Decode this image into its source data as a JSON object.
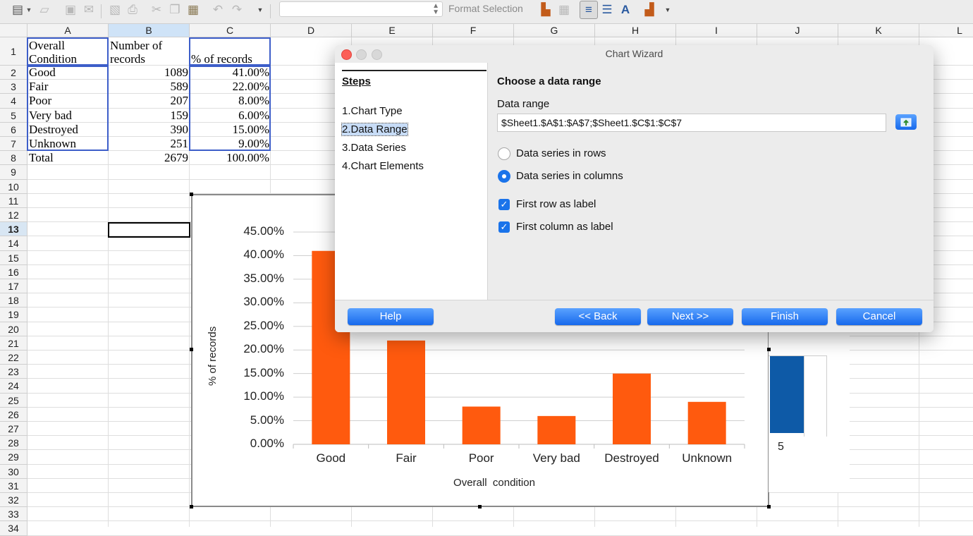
{
  "toolbar": {
    "format_selection_label": "Format Selection",
    "name_box_value": ""
  },
  "sheet": {
    "columns": [
      "A",
      "B",
      "C",
      "D",
      "E",
      "F",
      "G",
      "H",
      "I",
      "J",
      "K",
      "L"
    ],
    "rows": [
      "1",
      "2",
      "3",
      "4",
      "5",
      "6",
      "7",
      "8",
      "9",
      "10",
      "11",
      "12",
      "13",
      "14",
      "15",
      "16",
      "17",
      "18",
      "19",
      "20",
      "21",
      "22",
      "23",
      "24",
      "25",
      "26",
      "27",
      "28",
      "29",
      "30",
      "31",
      "32",
      "33",
      "34"
    ],
    "selected_row": "13",
    "header": {
      "a": "Overall Condition",
      "b": "Number of records",
      "c": "% of records"
    },
    "data_rows": [
      {
        "a": "Good",
        "b": "1089",
        "c": "41.00%"
      },
      {
        "a": "Fair",
        "b": "589",
        "c": "22.00%"
      },
      {
        "a": "Poor",
        "b": "207",
        "c": "8.00%"
      },
      {
        "a": "Very bad",
        "b": "159",
        "c": "6.00%"
      },
      {
        "a": "Destroyed",
        "b": "390",
        "c": "15.00%"
      },
      {
        "a": "Unknown",
        "b": "251",
        "c": "9.00%"
      },
      {
        "a": "Total",
        "b": "2679",
        "c": "100.00%"
      }
    ]
  },
  "chart_data": {
    "type": "bar",
    "categories": [
      "Good",
      "Fair",
      "Poor",
      "Very bad",
      "Destroyed",
      "Unknown"
    ],
    "values": [
      41,
      22,
      8,
      6,
      15,
      9
    ],
    "ylabel": "% of records",
    "xlabel": "Overall  condition",
    "ylim": [
      0,
      45
    ],
    "yticks": [
      "0.00%",
      "5.00%",
      "10.00%",
      "15.00%",
      "20.00%",
      "25.00%",
      "30.00%",
      "35.00%",
      "40.00%",
      "45.00%"
    ],
    "grid": true,
    "bar_color": "#ff5a0e"
  },
  "second_chart": {
    "tick_label": "5",
    "bar_color": "#0e5aa7"
  },
  "dialog": {
    "title": "Chart Wizard",
    "steps_title": "Steps",
    "steps": [
      {
        "num": "1.",
        "label": "Chart Type"
      },
      {
        "num": "2.",
        "label": "Data Range"
      },
      {
        "num": "3.",
        "label": "Data Series"
      },
      {
        "num": "4.",
        "label": "Chart Elements"
      }
    ],
    "heading": "Choose a data range",
    "data_range_label": "Data range",
    "data_range_value": "$Sheet1.$A$1:$A$7;$Sheet1.$C$1:$C$7",
    "radio_rows": "Data series in rows",
    "radio_columns": "Data series in columns",
    "check_first_row": "First row as label",
    "check_first_column": "First column as label",
    "buttons": {
      "help": "Help",
      "back": "<< Back",
      "next": "Next >>",
      "finish": "Finish",
      "cancel": "Cancel"
    }
  }
}
